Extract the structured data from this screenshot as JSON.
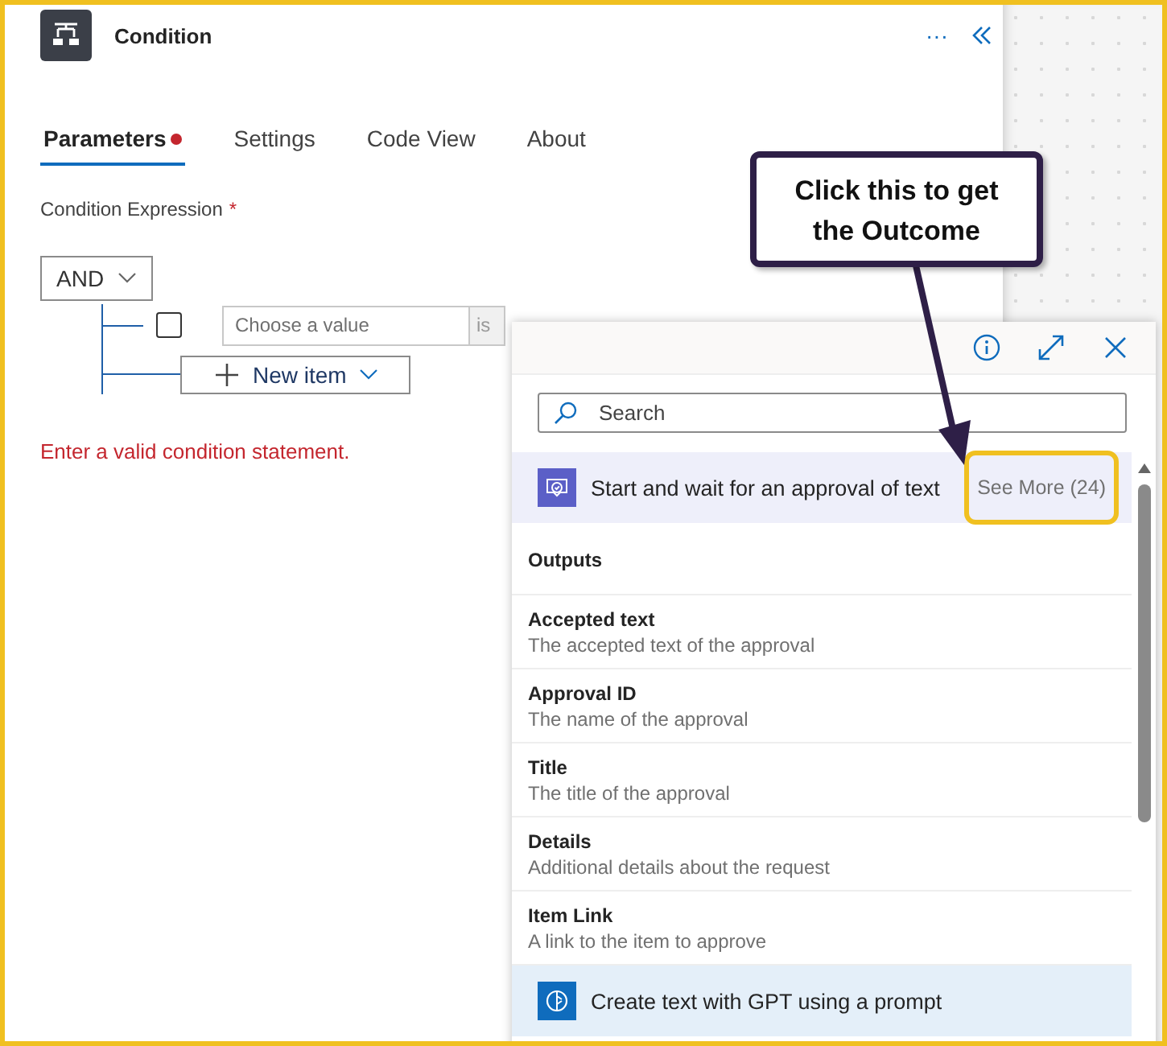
{
  "panel": {
    "title": "Condition",
    "more_menu": "···",
    "tabs": [
      {
        "label": "Parameters",
        "selected": true,
        "has_error": true
      },
      {
        "label": "Settings",
        "selected": false,
        "has_error": false
      },
      {
        "label": "Code View",
        "selected": false,
        "has_error": false
      },
      {
        "label": "About",
        "selected": false,
        "has_error": false
      }
    ],
    "expression_label": "Condition Expression",
    "required_mark": "*",
    "operator": "AND",
    "condition_row": {
      "checked": false,
      "value_placeholder": "Choose a value",
      "operator_text": "is"
    },
    "new_item_button": "New item",
    "error": "Enter a valid condition statement."
  },
  "picker": {
    "search_placeholder": "Search",
    "groups": [
      {
        "kind": "approval",
        "title": "Start and wait for an approval of text",
        "see_more": "See More (24)",
        "section": "Outputs",
        "items": [
          {
            "title": "Accepted text",
            "description": "The accepted text of the approval"
          },
          {
            "title": "Approval ID",
            "description": "The name of the approval"
          },
          {
            "title": "Title",
            "description": "The title of the approval"
          },
          {
            "title": "Details",
            "description": "Additional details about the request"
          },
          {
            "title": "Item Link",
            "description": "A link to the item to approve"
          }
        ]
      },
      {
        "kind": "gpt",
        "title": "Create text with GPT using a prompt"
      }
    ]
  },
  "callout": {
    "text": "Click this to get the Outcome"
  }
}
